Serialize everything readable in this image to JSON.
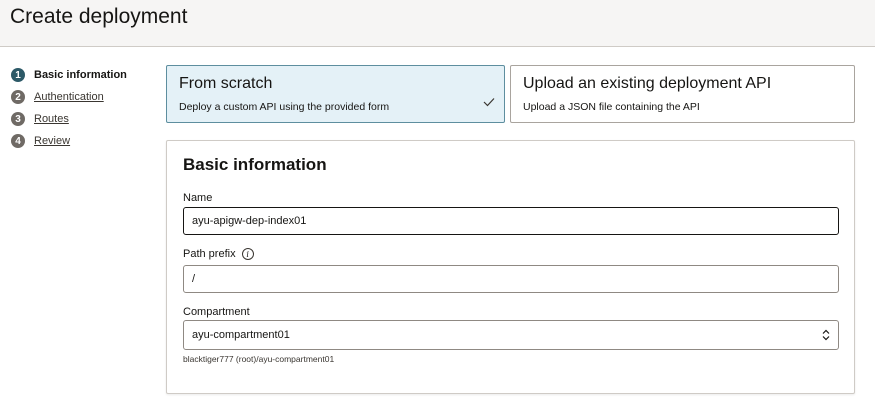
{
  "header": {
    "title": "Create deployment"
  },
  "steps": [
    {
      "num": "1",
      "label": "Basic information"
    },
    {
      "num": "2",
      "label": "Authentication"
    },
    {
      "num": "3",
      "label": "Routes"
    },
    {
      "num": "4",
      "label": "Review"
    }
  ],
  "choices": {
    "scratch": {
      "title": "From scratch",
      "desc": "Deploy a custom API using the provided form"
    },
    "upload": {
      "title": "Upload an existing deployment API",
      "desc": "Upload a JSON file containing the API"
    }
  },
  "form": {
    "title": "Basic information",
    "name": {
      "label": "Name",
      "value": "ayu-apigw-dep-index01"
    },
    "path_prefix": {
      "label": "Path prefix",
      "value": "/"
    },
    "compartment": {
      "label": "Compartment",
      "value": "ayu-compartment01",
      "hint": "blacktiger777 (root)/ayu-compartment01"
    }
  },
  "colors": {
    "accent": "#2c5967",
    "selected_bg": "#e4f1f7"
  },
  "icons": {
    "info": "info-icon",
    "check": "checkmark-icon",
    "select_arrow": "chevron-up-down-icon"
  }
}
